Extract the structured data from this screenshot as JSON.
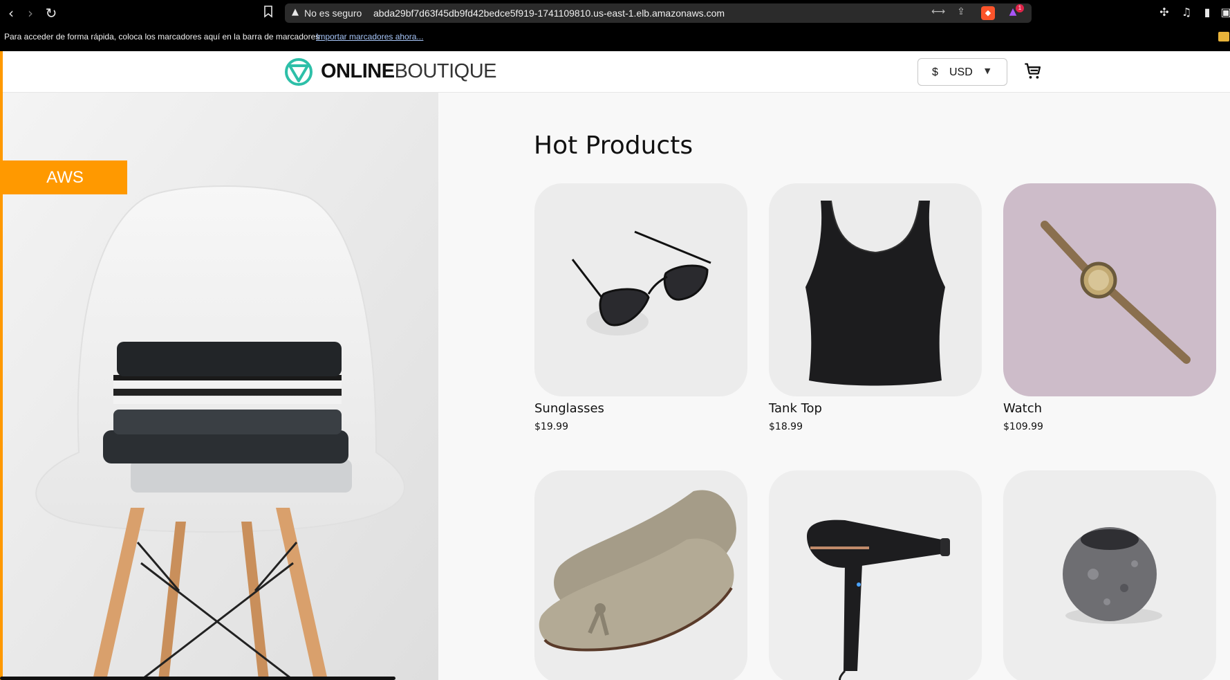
{
  "browser": {
    "back_icon": "‹",
    "forward_icon": "›",
    "reload_icon": "↻",
    "bookmark_icon": "bookmark-icon",
    "security_label": "No es seguro",
    "url": "abda29bf7d63f45db9fd42bedce5f919-1741109810.us-east-1.elb.amazonaws.com",
    "rewards_badge": "1"
  },
  "bookmarks_bar": {
    "text": "Para acceder de forma rápida, coloca los marcadores aquí en la barra de marcadores",
    "import_link": "Importar marcadores ahora..."
  },
  "header": {
    "logo_bold": "ONLINE",
    "logo_light": "BOUTIQUE",
    "currency_symbol": "$",
    "currency_value": "USD"
  },
  "hero": {
    "badge": "AWS"
  },
  "main": {
    "title": "Hot Products",
    "products": [
      {
        "name": "Sunglasses",
        "price": "$19.99"
      },
      {
        "name": "Tank Top",
        "price": "$18.99"
      },
      {
        "name": "Watch",
        "price": "$109.99"
      },
      {
        "name": "",
        "price": ""
      },
      {
        "name": "",
        "price": ""
      },
      {
        "name": "",
        "price": ""
      }
    ]
  },
  "colors": {
    "accent": "#ff9900",
    "logo_teal": "#2dbfa8"
  }
}
